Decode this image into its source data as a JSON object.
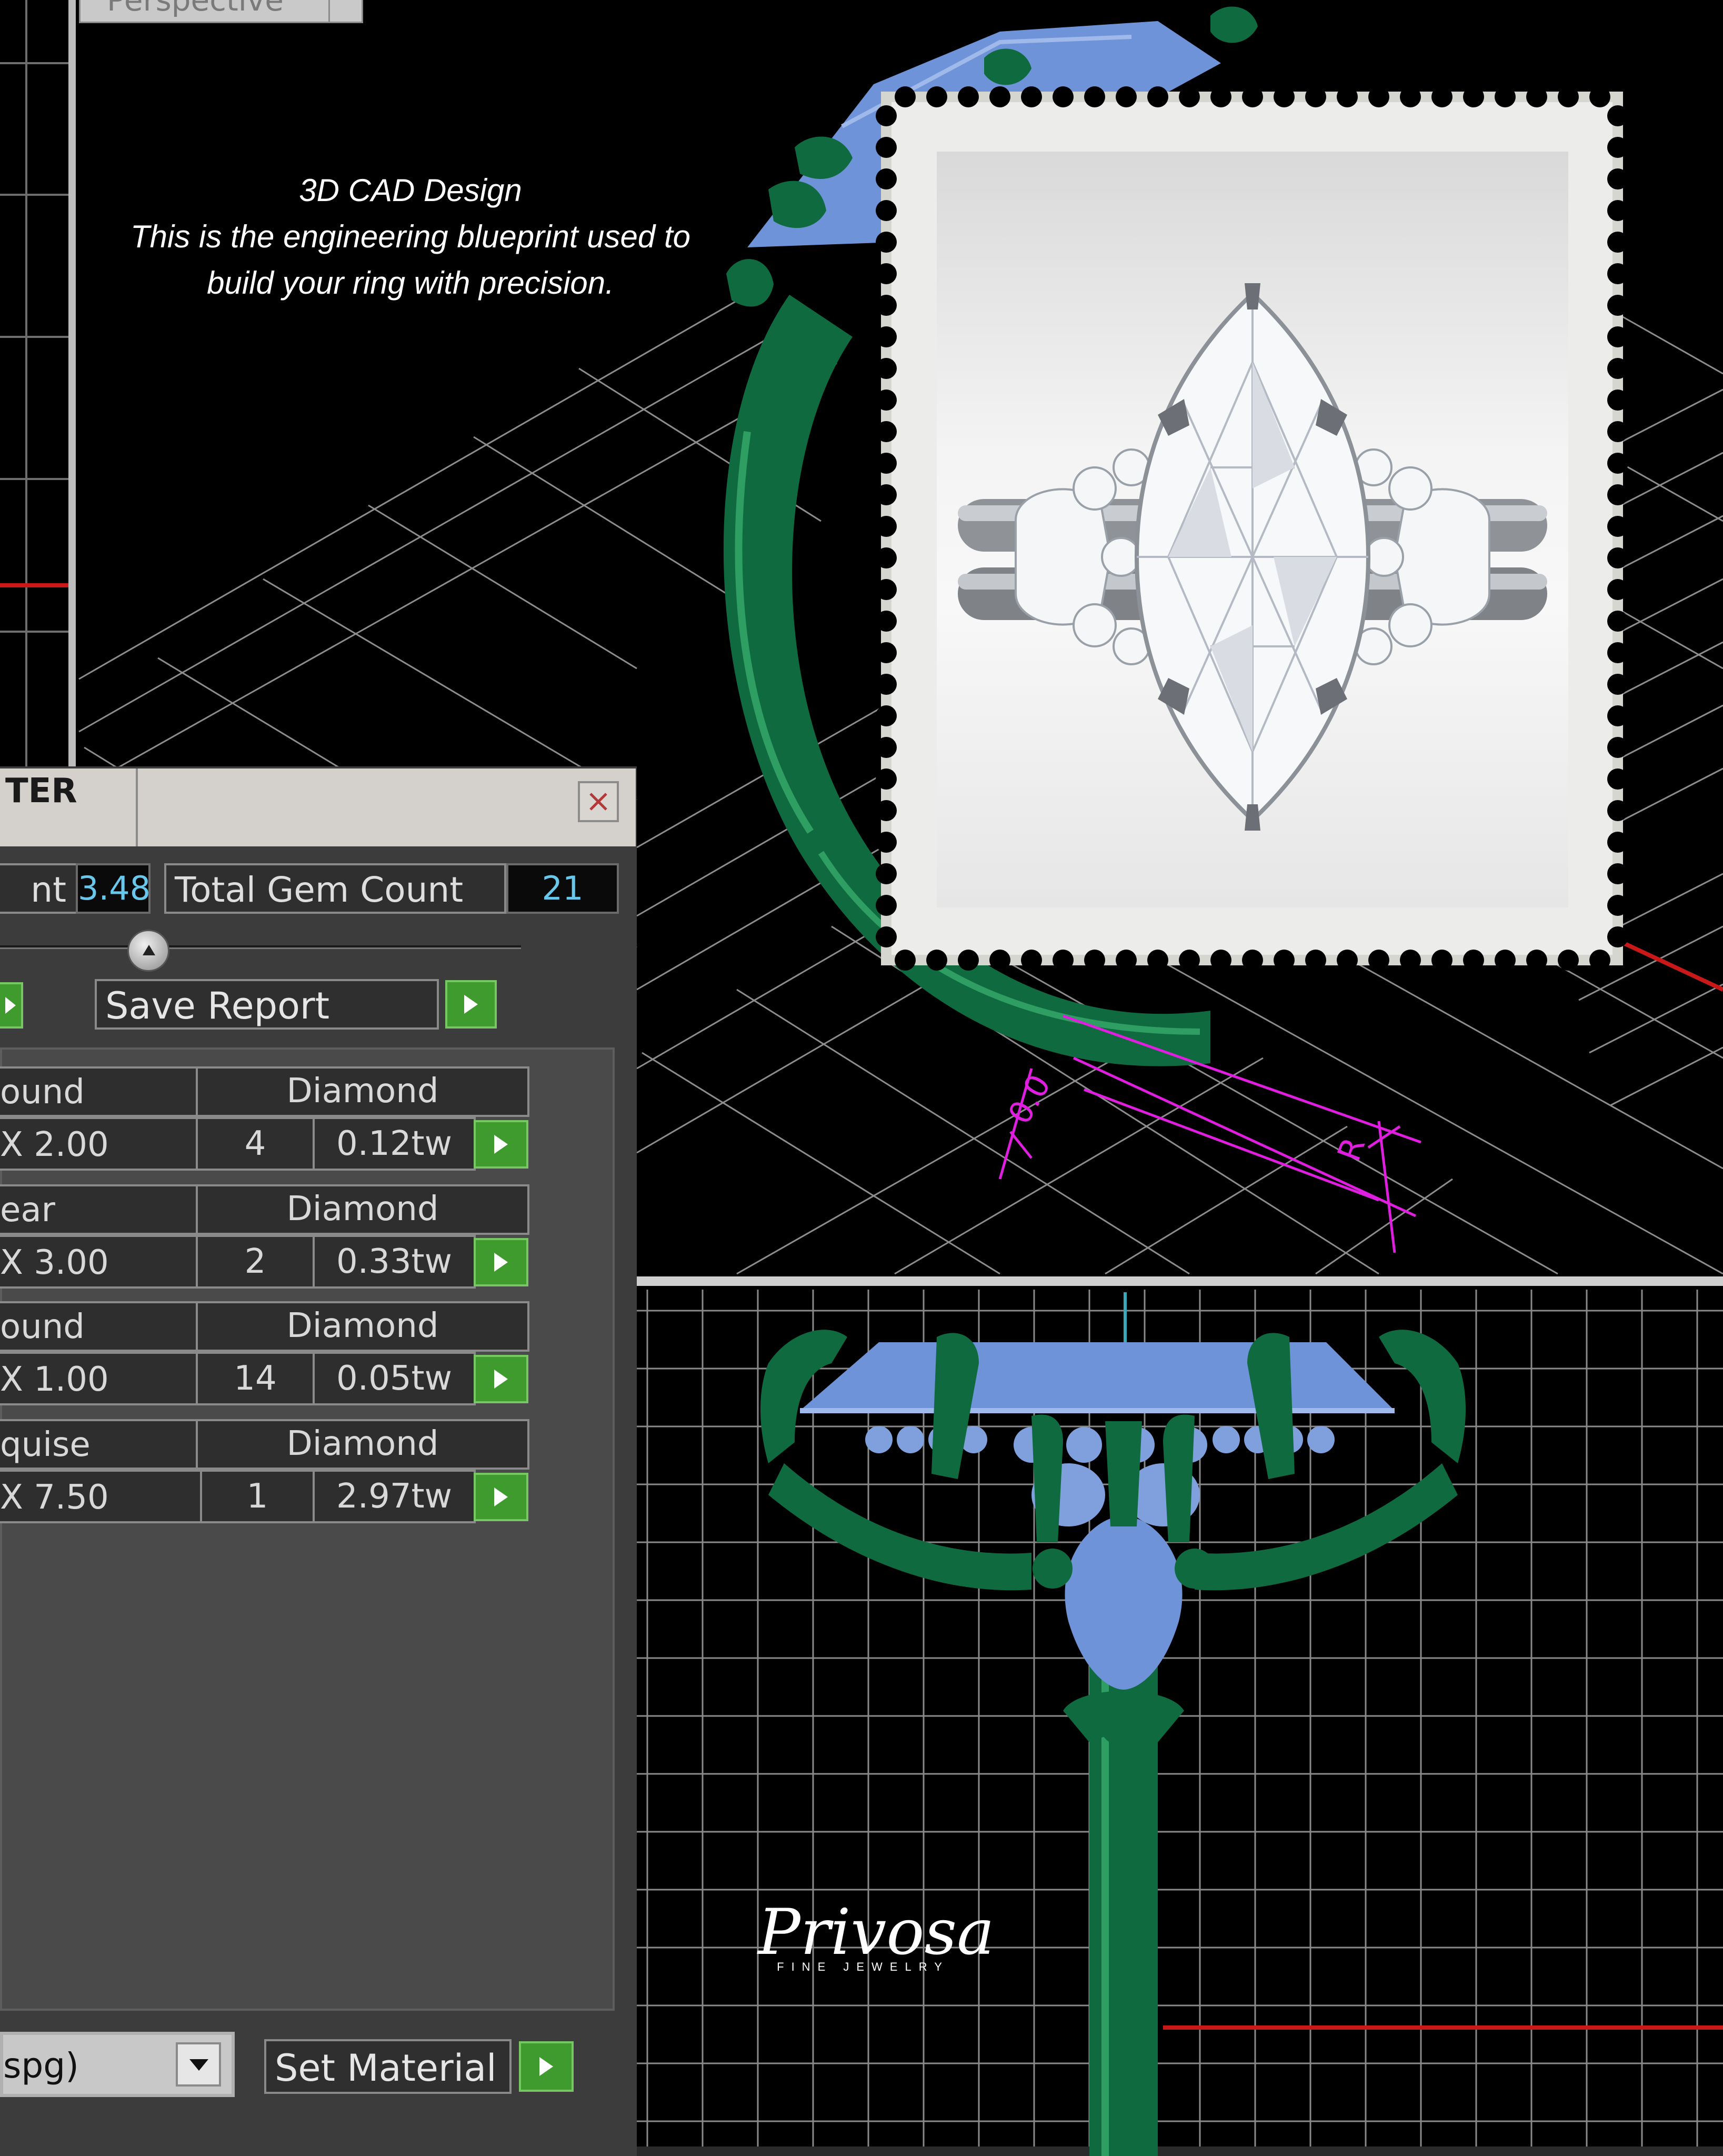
{
  "viewport": {
    "tab_label": "Perspective"
  },
  "caption": {
    "line1": "3D CAD Design",
    "line2": "This is the engineering blueprint used to",
    "line3": "build your ring with precision."
  },
  "gem_panel": {
    "title": "TER",
    "weight_label": "nt",
    "weight_value": "3.48",
    "count_label": "Total Gem Count",
    "count_value": "21",
    "save_report_label": "Save Report",
    "gems": [
      {
        "shape": "ound",
        "type": "Diamond",
        "size": "X 2.00",
        "count": "4",
        "weight": "0.12tw"
      },
      {
        "shape": "ear",
        "type": "Diamond",
        "size": "X 3.00",
        "count": "2",
        "weight": "0.33tw"
      },
      {
        "shape": "ound",
        "type": "Diamond",
        "size": "X 1.00",
        "count": "14",
        "weight": "0.05tw"
      },
      {
        "shape": "quise",
        "type": "Diamond",
        "size": "X 7.50",
        "count": "1",
        "weight": "2.97tw"
      }
    ],
    "material_value": "spg)",
    "set_material_label": "Set Material"
  },
  "brand": {
    "name": "Privosa",
    "tagline": "FINE JEWELRY"
  },
  "colors": {
    "background": "#000000",
    "grid": "#9a9a9a",
    "metal_cad": "#0f6b3f",
    "gem_cad": "#6f93d8",
    "dimension": "#e01ee0",
    "axis_red": "#c81818",
    "action_green": "#3f9b2e",
    "readout_cyan": "#67c8ec"
  }
}
